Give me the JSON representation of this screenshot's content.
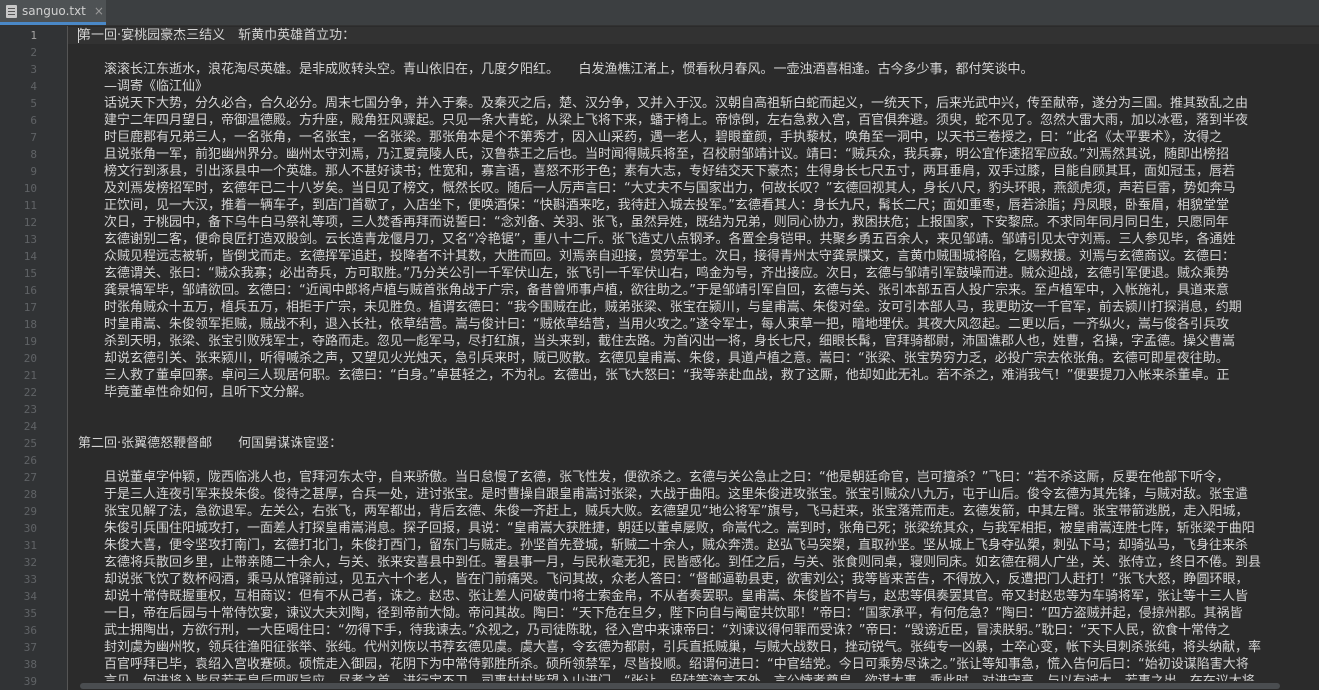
{
  "tab": {
    "label": "sanguo.txt",
    "close_glyph": "×"
  },
  "editor": {
    "current_line": 1,
    "lines": [
      "第一回·宴桃园豪杰三结义　斩黄巾英雄首立功：",
      "",
      "　　滚滚长江东逝水，浪花淘尽英雄。是非成败转头空。青山依旧在，几度夕阳红。　　白发渔樵江渚上，惯看秋月春风。一壶浊酒喜相逢。古今多少事，都付笑谈中。",
      "　　—调寄《临江仙》",
      "　　话说天下大势，分久必合，合久必分。周末七国分争，并入于秦。及秦灭之后，楚、汉分争，又并入于汉。汉朝自高祖斩白蛇而起义，一统天下，后来光武中兴，传至献帝，遂分为三国。推其致乱之由",
      "　　建宁二年四月望日，帝御温德殿。方升座，殿角狂风骤起。只见一条大青蛇，从梁上飞将下来，蟠于椅上。帝惊倒，左右急救入宫，百官俱奔避。须臾，蛇不见了。忽然大雷大雨，加以冰雹，落到半夜",
      "　　时巨鹿郡有兄弟三人，一名张角，一名张宝，一名张梁。那张角本是个不第秀才，因入山采药，遇一老人，碧眼童颜，手执藜杖，唤角至一洞中，以天书三卷授之，曰：“此名《太平要术》，汝得之",
      "　　且说张角一军，前犯幽州界分。幽州太守刘焉，乃江夏竟陵人氏，汉鲁恭王之后也。当时闻得贼兵将至，召校尉邹靖计议。靖曰：“贼兵众，我兵寡，明公宜作速招军应敌。”刘焉然其说，随即出榜招",
      "　　榜文行到涿县，引出涿县中一个英雄。那人不甚好读书；性宽和，寡言语，喜怒不形于色；素有大志，专好结交天下豪杰；生得身长七尺五寸，两耳垂肩，双手过膝，目能自顾其耳，面如冠玉，唇若",
      "　　及刘焉发榜招军时，玄德年已二十八岁矣。当日见了榜文，慨然长叹。随后一人厉声言曰：“大丈夫不与国家出力，何故长叹？”玄德回视其人，身长八尺，豹头环眼，燕颔虎须，声若巨雷，势如奔马",
      "　　正饮间，见一大汉，推着一辆车子，到店门首歇了，入店坐下，便唤酒保：“快斟酒来吃，我待赶入城去投军。”玄德看其人：身长九尺，髯长二尺；面如重枣，唇若涂脂；丹凤眼，卧蚕眉，相貌堂堂",
      "　　次日，于桃园中，备下乌牛白马祭礼等项，三人焚香再拜而说誓曰：“念刘备、关羽、张飞，虽然异姓，既结为兄弟，则同心协力，救困扶危；上报国家，下安黎庶。不求同年同月同日生，只愿同年",
      "　　玄德谢别二客，便命良匠打造双股剑。云长造青龙偃月刀，又名“冷艳锯”，重八十二斤。张飞造丈八点钢矛。各置全身铠甲。共聚乡勇五百余人，来见邹靖。邹靖引见太守刘焉。三人参见毕，各通姓",
      "　　众贼见程远志被斩，皆倒戈而走。玄德挥军追赶，投降者不计其数，大胜而回。刘焉亲自迎接，赏劳军士。次日，接得青州太守龚景牒文，言黄巾贼围城将陷，乞赐救援。刘焉与玄德商议。玄德曰：",
      "　　玄德谓关、张曰：“贼众我寡；必出奇兵，方可取胜。”乃分关公引一千军伏山左，张飞引一千军伏山右，鸣金为号，齐出接应。次日，玄德与邹靖引军鼓噪而进。贼众迎战，玄德引军便退。贼众乘势",
      "　　龚景犒军毕，邹靖欲回。玄德曰：“近闻中郎将卢植与贼首张角战于广宗，备昔曾师事卢植，欲往助之。”于是邹靖引军自回，玄德与关、张引本部五百人投广宗来。至卢植军中，入帐施礼，具道来意",
      "　　时张角贼众十五万，植兵五万，相拒于广宗，未见胜负。植谓玄德曰：“我今围贼在此，贼弟张梁、张宝在颍川，与皇甫嵩、朱俊对垒。汝可引本部人马，我更助汝一千官军，前去颍川打探消息，约期",
      "　　时皇甫嵩、朱俊领军拒贼，贼战不利，退入长社，依草结营。嵩与俊计曰：“贼依草结营，当用火攻之。”遂令军士，每人束草一把，暗地埋伏。其夜大风忽起。二更以后，一齐纵火，嵩与俊各引兵攻",
      "　　杀到天明，张梁、张宝引败残军士，夺路而走。忽见一彪军马，尽打红旗，当头来到，截住去路。为首闪出一将，身长七尺，细眼长髯，官拜骑都尉，沛国谯郡人也，姓曹，名操，字孟德。操父曹嵩",
      "　　却说玄德引关、张来颍川，听得喊杀之声，又望见火光烛天，急引兵来时，贼已败散。玄德见皇甫嵩、朱俊，具道卢植之意。嵩曰：“张梁、张宝势穷力乏，必投广宗去依张角。玄德可即星夜往助。",
      "　　三人救了董卓回寨。卓问三人现居何职。玄德曰：“白身。”卓甚轻之，不为礼。玄德出，张飞大怒曰：“我等亲赴血战，救了这厮，他却如此无礼。若不杀之，难消我气！”便要提刀入帐来杀董卓。正",
      "　　毕竟董卓性命如何，且听下文分解。",
      "",
      "",
      "第二回·张翼德怒鞭督邮　　何国舅谋诛宦竖：",
      "",
      "　　且说董卓字仲颖，陇西临洮人也，官拜河东太守，自来骄傲。当日怠慢了玄德，张飞性发，便欲杀之。玄德与关公急止之曰：“他是朝廷命官，岂可擅杀？”飞曰：“若不杀这厮，反要在他部下听令，",
      "　　于是三人连夜引军来投朱俊。俊待之甚厚，合兵一处，进讨张宝。是时曹操自跟皇甫嵩讨张梁，大战于曲阳。这里朱俊进攻张宝。张宝引贼众八九万，屯于山后。俊令玄德为其先锋，与贼对敌。张宝遣",
      "　　张宝见解了法，急欲退军。左关公，右张飞，两军都出，背后玄德、朱俊一齐赶上，贼兵大败。玄德望见“地公将军”旗号，飞马赶来，张宝落荒而走。玄德发箭，中其左臂。张宝带箭逃脱，走入阳城，",
      "　　朱俊引兵围住阳城攻打，一面差人打探皇甫嵩消息。探子回报，具说：“皇甫嵩大获胜捷，朝廷以董卓屡败，命嵩代之。嵩到时，张角已死；张梁统其众，与我军相拒，被皇甫嵩连胜七阵，斩张梁于曲阳",
      "　　朱俊大喜，便令坚攻打南门，玄德打北门，朱俊打西门，留东门与贼走。孙坚首先登城，斩贼二十余人，贼众奔溃。赵弘飞马突槊，直取孙坚。坚从城上飞身夺弘槊，刺弘下马；却骑弘马，飞身往来杀",
      "　　玄德将兵散回乡里，止带亲随二十余人，与关、张来安喜县中到任。署县事一月，与民秋毫无犯，民皆感化。到任之后，与关、张食则同桌，寝则同床。如玄德在稠人广坐，关、张侍立，终日不倦。到县",
      "　　却说张飞饮了数杯闷酒，乘马从馆驿前过，见五六十个老人，皆在门前痛哭。飞问其故，众老人答曰：“督邮逼勒县吏，欲害刘公；我等皆来苦告，不得放入，反遭把门人赶打！”张飞大怒，睁圆环眼，",
      "　　却说十常侍既握重权，互相商议：但有不从己者，诛之。赵忠、张让差人问破黄巾将士索金帛，不从者奏罢职。皇甫嵩、朱俊皆不肯与，赵忠等俱奏罢其官。帝又封赵忠等为车骑将军，张让等十三人皆",
      "　　一日，帝在后园与十常侍饮宴，谏议大夫刘陶，径到帝前大恸。帝问其故。陶曰：“天下危在旦夕，陛下向自与阉宦共饮耶！”帝曰：“国家承平，有何危急？”陶曰：“四方盗贼并起，侵掠州郡。其祸皆",
      "　　武士拥陶出，方欲行刑，一大臣喝住曰：“勿得下手，待我谏去。”众视之，乃司徒陈耽，径入宫中来谏帝曰：“刘谏议得何罪而受诛？”帝曰：“毁谤近臣，冒渎朕躬。”耽曰：“天下人民，欲食十常侍之",
      "　　封刘虞为幽州牧，领兵往渔阳征张举、张纯。代州刘恢以书荐玄德见虞。虞大喜，令玄德为都尉，引兵直抵贼巢，与贼大战数日，挫动锐气。张纯专一凶暴，士卒心变，帐下头目刺杀张纯，将头纳献，率",
      "　　百官呼拜已毕，袁绍入宫收蹇硕。硕慌走入御园，花阴下为中常侍郭胜所杀。硕所领禁军，尽皆投顺。绍谓何进曰：“中官结党。今日可乘势尽诛之。”张让等知事急，慌入告何后曰：“始初设谋陷害大将",
      "　　言见，何进将入皆尽若无皇后四驱旨应，尽孝之首，进行宝不卫，司事村村皆望入山进门。“张让，段硅等流言不外，言公悖孝尊皇，欲谋大事，乘此时，对进守高，与以有诚大。若事之出，在在议大将"
    ]
  }
}
